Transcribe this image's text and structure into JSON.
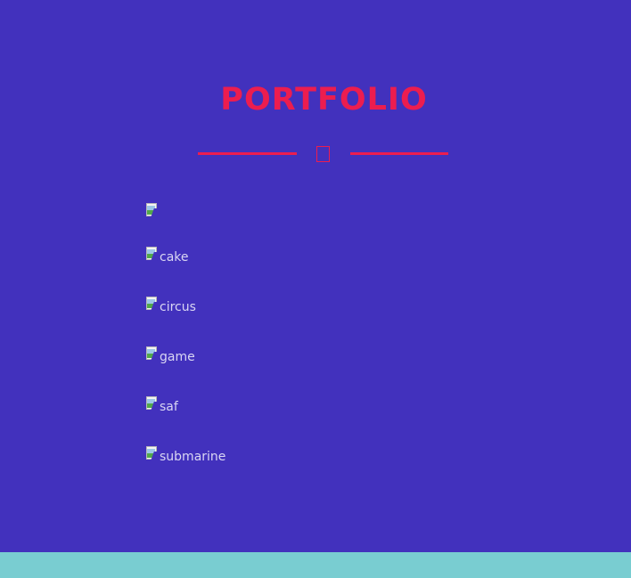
{
  "portfolio": {
    "title": "PORTFOLIO",
    "divider_icon": "star-icon",
    "items": [
      {
        "alt": ""
      },
      {
        "alt": "cake"
      },
      {
        "alt": "circus"
      },
      {
        "alt": "game"
      },
      {
        "alt": "saf"
      },
      {
        "alt": "submarine"
      }
    ]
  },
  "colors": {
    "background": "#4231bd",
    "accent": "#ec1d4f",
    "footer": "#79cdd1"
  }
}
